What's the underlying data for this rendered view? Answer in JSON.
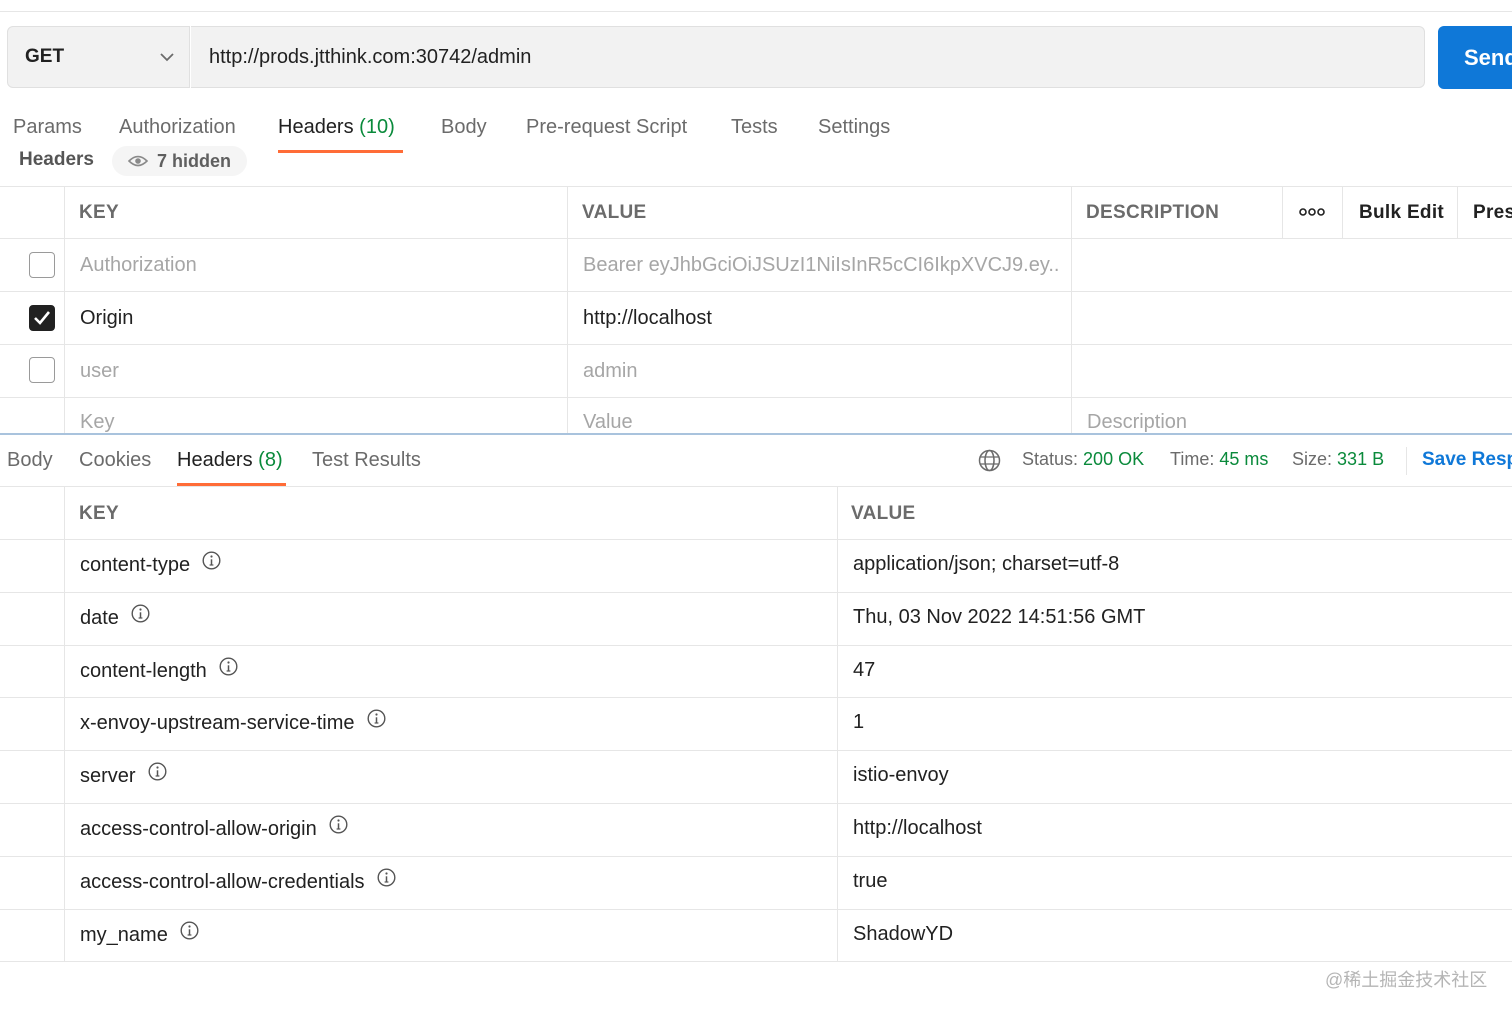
{
  "request": {
    "method": "GET",
    "url": "http://prods.jtthink.com:30742/admin",
    "send_label": "Send"
  },
  "request_tabs": [
    {
      "label": "Params"
    },
    {
      "label": "Authorization"
    },
    {
      "label": "Headers",
      "count": "(10)"
    },
    {
      "label": "Body"
    },
    {
      "label": "Pre-request Script"
    },
    {
      "label": "Tests"
    },
    {
      "label": "Settings"
    }
  ],
  "headers_section": {
    "title": "Headers",
    "hidden_label": "7 hidden"
  },
  "request_table": {
    "columns": {
      "key": "KEY",
      "value": "VALUE",
      "description": "DESCRIPTION"
    },
    "actions": {
      "more_icon": "ellipsis-icon",
      "bulk_edit": "Bulk Edit",
      "presets": "Presets"
    },
    "rows": [
      {
        "key": "Authorization",
        "value": "Bearer eyJhbGciOiJSUzI1NiIsInR5cCI6IkpXVCJ9.ey...",
        "checked": false
      },
      {
        "key": "Origin",
        "value": "http://localhost",
        "checked": true
      },
      {
        "key": "user",
        "value": "admin",
        "checked": false
      }
    ],
    "placeholders": {
      "key": "Key",
      "value": "Value",
      "description": "Description"
    }
  },
  "response_tabs": [
    {
      "label": "Body"
    },
    {
      "label": "Cookies"
    },
    {
      "label": "Headers",
      "count": "(8)"
    },
    {
      "label": "Test Results"
    }
  ],
  "response_status": {
    "globe_icon": "globe-icon",
    "status_label": "Status:",
    "status_value": "200 OK",
    "time_label": "Time:",
    "time_value": "45 ms",
    "size_label": "Size:",
    "size_value": "331 B",
    "save_label": "Save Response"
  },
  "response_table": {
    "columns": {
      "key": "KEY",
      "value": "VALUE"
    },
    "rows": [
      {
        "key": "content-type",
        "value": "application/json; charset=utf-8"
      },
      {
        "key": "date",
        "value": "Thu, 03 Nov 2022 14:51:56 GMT"
      },
      {
        "key": "content-length",
        "value": "47"
      },
      {
        "key": "x-envoy-upstream-service-time",
        "value": "1"
      },
      {
        "key": "server",
        "value": "istio-envoy"
      },
      {
        "key": "access-control-allow-origin",
        "value": "http://localhost"
      },
      {
        "key": "access-control-allow-credentials",
        "value": "true"
      },
      {
        "key": "my_name",
        "value": "ShadowYD"
      }
    ]
  },
  "watermark": "@稀土掘金技术社区",
  "colors": {
    "accent_orange": "#ff6c37",
    "send_blue": "#0f78d8",
    "success_green": "#0a8a3b"
  }
}
